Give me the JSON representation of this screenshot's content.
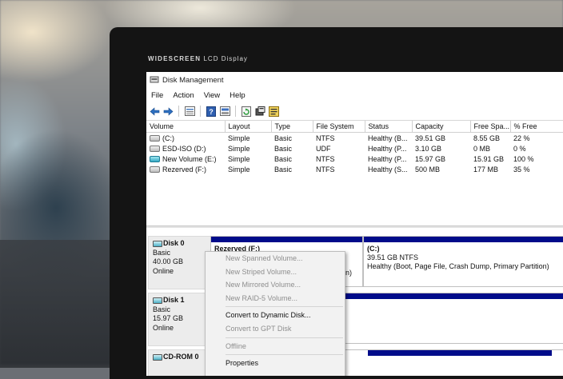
{
  "monitor": {
    "brand_bold": "WIDESCREEN",
    "brand_rest": "LCD Display"
  },
  "window": {
    "title": "Disk Management"
  },
  "menu": [
    "File",
    "Action",
    "View",
    "Help"
  ],
  "toolbar_icons": [
    "back-icon",
    "forward-icon",
    "list-view-icon",
    "help-icon",
    "disk-view-icon",
    "refresh-icon",
    "rescan-icon",
    "properties-icon"
  ],
  "volumes": {
    "columns": [
      "Volume",
      "Layout",
      "Type",
      "File System",
      "Status",
      "Capacity",
      "Free Spa...",
      "% Free"
    ],
    "rows": [
      {
        "icon": "drive-icon",
        "cells": [
          "(C:)",
          "Simple",
          "Basic",
          "NTFS",
          "Healthy (B...",
          "39.51 GB",
          "8.55 GB",
          "22 %"
        ]
      },
      {
        "icon": "drive-icon",
        "cells": [
          "ESD-ISO (D:)",
          "Simple",
          "Basic",
          "UDF",
          "Healthy (P...",
          "3.10 GB",
          "0 MB",
          "0 %"
        ]
      },
      {
        "icon": "drive-icon-cyan",
        "cells": [
          "New Volume (E:)",
          "Simple",
          "Basic",
          "NTFS",
          "Healthy (P...",
          "15.97 GB",
          "15.91 GB",
          "100 %"
        ]
      },
      {
        "icon": "drive-icon",
        "cells": [
          "Rezerved (F:)",
          "Simple",
          "Basic",
          "NTFS",
          "Healthy (S...",
          "500 MB",
          "177 MB",
          "35 %"
        ]
      }
    ]
  },
  "disks": [
    {
      "name": "Disk 0",
      "type": "Basic",
      "size": "40.00 GB",
      "state": "Online"
    },
    {
      "name": "Disk 1",
      "type": "Basic",
      "size": "15.97 GB",
      "state": "Online"
    },
    {
      "name": "CD-ROM 0",
      "type": "",
      "size": "",
      "state": ""
    }
  ],
  "partitions": {
    "disk0_reserved": {
      "label": "Rezerved (F:)",
      "status_tail": "n)"
    },
    "disk0_c": {
      "label": "(C:)",
      "size": "39.51 GB NTFS",
      "status": "Healthy (Boot, Page File, Crash Dump, Primary Partition)"
    }
  },
  "context_menu": [
    {
      "label": "New Spanned Volume...",
      "disabled": true
    },
    {
      "label": "New Striped Volume...",
      "disabled": true
    },
    {
      "label": "New Mirrored Volume...",
      "disabled": true
    },
    {
      "label": "New RAID-5 Volume...",
      "disabled": true
    },
    {
      "sep": true
    },
    {
      "label": "Convert to Dynamic Disk...",
      "disabled": false
    },
    {
      "label": "Convert to GPT Disk",
      "disabled": true
    },
    {
      "sep": true
    },
    {
      "label": "Offline",
      "disabled": true
    },
    {
      "sep": true
    },
    {
      "label": "Properties",
      "disabled": false
    }
  ],
  "colors": {
    "partition_bar": "#000c8a",
    "window_bg": "#ffffff",
    "bezel": "#141414"
  }
}
